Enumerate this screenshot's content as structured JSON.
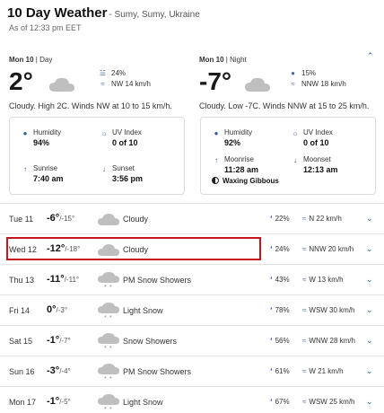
{
  "header": {
    "title": "10 Day Weather",
    "location": "- Sumy, Sumy, Ukraine",
    "as_of": "As of 12:33 pm EET"
  },
  "day": {
    "label_day": "Mon 10",
    "label_sep": "| Day",
    "temp": "2°",
    "precip": "24%",
    "wind": "NW 14 km/h",
    "summary": "Cloudy. High 2C. Winds NW at 10 to 15 km/h.",
    "humidity_label": "Humidity",
    "humidity": "94%",
    "uv_label": "UV Index",
    "uv": "0 of 10",
    "sunrise_label": "Sunrise",
    "sunrise": "7:40 am",
    "sunset_label": "Sunset",
    "sunset": "3:56 pm"
  },
  "night": {
    "label_day": "Mon 10",
    "label_sep": "| Night",
    "temp": "-7°",
    "precip": "15%",
    "wind": "NNW 18 km/h",
    "summary": "Cloudy. Low -7C. Winds NNW at 15 to 25 km/h.",
    "humidity_label": "Humidity",
    "humidity": "92%",
    "uv_label": "UV Index",
    "uv": "0 of 10",
    "moonrise_label": "Moonrise",
    "moonrise": "11:28 am",
    "moonset_label": "Moonset",
    "moonset": "12:13 am",
    "moon_phase": "Waxing Gibbous"
  },
  "forecast": [
    {
      "day": "Tue 11",
      "high": "-6°",
      "low": "/-15°",
      "icon": "cloud",
      "condition": "Cloudy",
      "precip": "22%",
      "wind": "N 22 km/h"
    },
    {
      "day": "Wed 12",
      "high": "-12°",
      "low": "/-18°",
      "icon": "cloud",
      "condition": "Cloudy",
      "precip": "24%",
      "wind": "NNW 20 km/h"
    },
    {
      "day": "Thu 13",
      "high": "-11°",
      "low": "/-11°",
      "icon": "snow",
      "condition": "PM Snow Showers",
      "precip": "43%",
      "wind": "W 13 km/h"
    },
    {
      "day": "Fri 14",
      "high": "0°",
      "low": "/-3°",
      "icon": "snow",
      "condition": "Light Snow",
      "precip": "78%",
      "wind": "WSW 30 km/h"
    },
    {
      "day": "Sat 15",
      "high": "-1°",
      "low": "/-7°",
      "icon": "snow",
      "condition": "Snow Showers",
      "precip": "56%",
      "wind": "WNW 28 km/h"
    },
    {
      "day": "Sun 16",
      "high": "-3°",
      "low": "/-4°",
      "icon": "snow",
      "condition": "PM Snow Showers",
      "precip": "61%",
      "wind": "W 21 km/h"
    },
    {
      "day": "Mon 17",
      "high": "-1°",
      "low": "/-5°",
      "icon": "snow",
      "condition": "Light Snow",
      "precip": "67%",
      "wind": "WSW 25 km/h"
    }
  ],
  "colors": {
    "accent": "#2e5e9e",
    "highlight": "#c8151d",
    "cloud": "#bfbfbf"
  }
}
